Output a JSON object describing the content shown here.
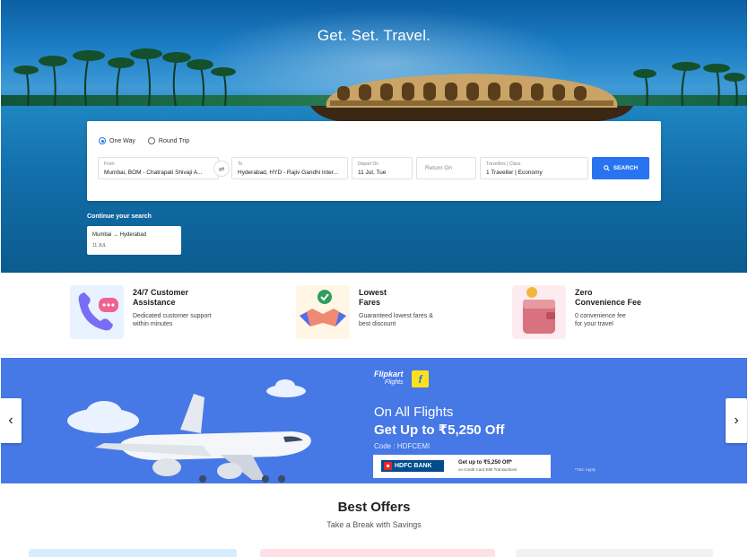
{
  "hero": {
    "title": "Get. Set. Travel."
  },
  "search": {
    "trip_types": [
      {
        "label": "One Way",
        "selected": true
      },
      {
        "label": "Round Trip",
        "selected": false
      }
    ],
    "from": {
      "label": "From",
      "value": "Mumbai, BOM - Chatrapati Shivaji A..."
    },
    "swap_icon": "swap-icon",
    "to": {
      "label": "To",
      "value": "Hyderabad, HYD - Rajiv Gandhi Inter..."
    },
    "depart": {
      "label": "Depart On",
      "value": "11 Jul, Tue"
    },
    "return": {
      "placeholder": "Return On"
    },
    "travellers": {
      "label": "Travellers | Class",
      "value": "1 Traveller | Economy"
    },
    "button_label": "SEARCH",
    "accent": "#2874f0"
  },
  "recent": {
    "title": "Continue your search",
    "route": "Mumbai → Hyderabad",
    "date": "11 JUL"
  },
  "features": [
    {
      "title": "24/7 Customer Assistance",
      "title_l1": "24/7 Customer",
      "title_l2": "Assistance",
      "desc_l1": "Dedicated customer support",
      "desc_l2": "within minutes",
      "icon": "phone-support-icon"
    },
    {
      "title_l1": "Lowest",
      "title_l2": "Fares",
      "desc_l1": "Guaranteed lowest fares &",
      "desc_l2": "best discount",
      "icon": "handshake-icon"
    },
    {
      "title_l1": "Zero",
      "title_l2": "Convenience Fee",
      "desc_l1": "0 convenience fee",
      "desc_l2": "for your travel",
      "icon": "wallet-icon"
    }
  ],
  "banner": {
    "brand": "Flipkart",
    "brand_sub": "Flights",
    "line1": "On All Flights",
    "line2": "Get Up to ₹5,250 Off",
    "code": "Code : HDFCEMI",
    "bank": "HDFC BANK",
    "bank_offer": "Get up to ₹5,250 Off*",
    "bank_offer_sub": "on Credit Card EMI Transactions",
    "tc": "*T&C Apply",
    "background": "#4678e6"
  },
  "offers": {
    "title": "Best Offers",
    "subtitle": "Take a Break with Savings"
  }
}
